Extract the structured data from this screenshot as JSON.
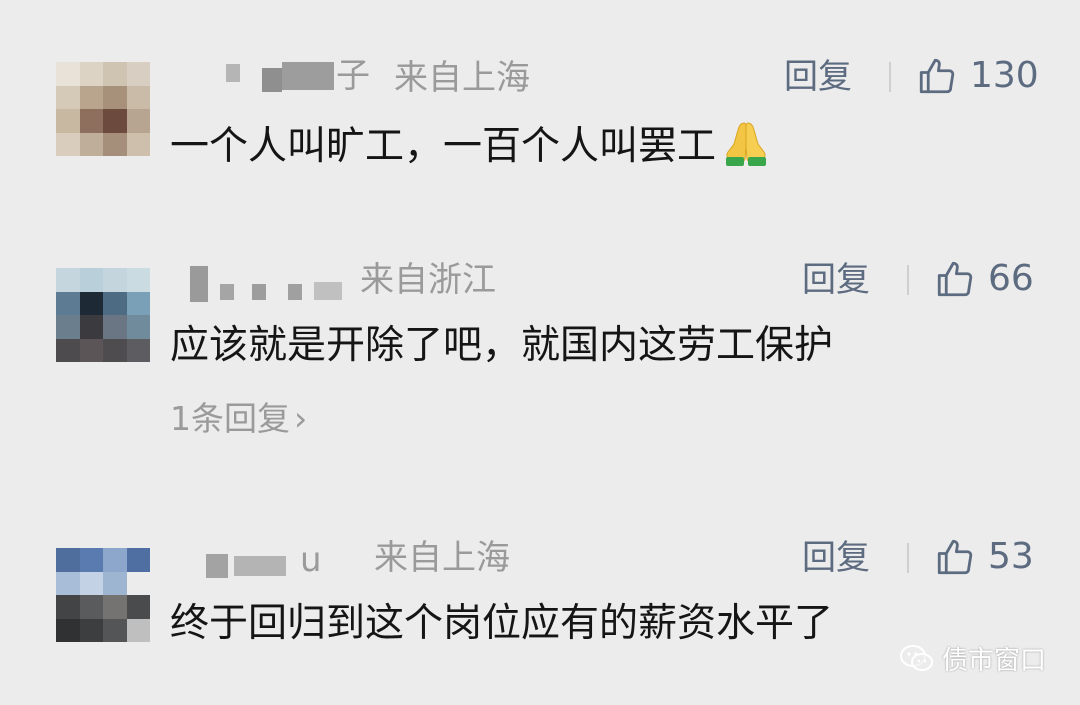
{
  "comments": [
    {
      "username": "子",
      "location": "来自上海",
      "reply_label": "回复",
      "likes": "130",
      "text": "一个人叫旷工，一百个人叫罢工",
      "emoji": "folded-hands-icon",
      "sub_replies": ""
    },
    {
      "username": "",
      "location": "来自浙江",
      "reply_label": "回复",
      "likes": "66",
      "text": "应该就是开除了吧，就国内这劳工保护",
      "emoji": "",
      "sub_replies": "1条回复",
      "sub_replies_chevron": "›"
    },
    {
      "username": "u",
      "location": "来自上海",
      "reply_label": "回复",
      "likes": "53",
      "text": "终于回归到这个岗位应有的薪资水平了",
      "emoji": "",
      "sub_replies": ""
    }
  ],
  "watermark": {
    "icon": "wechat-icon",
    "text": "债市窗口"
  },
  "colors": {
    "background": "#ececec",
    "action": "#5d6b80",
    "muted": "#9a9a9a",
    "text": "#151515"
  }
}
